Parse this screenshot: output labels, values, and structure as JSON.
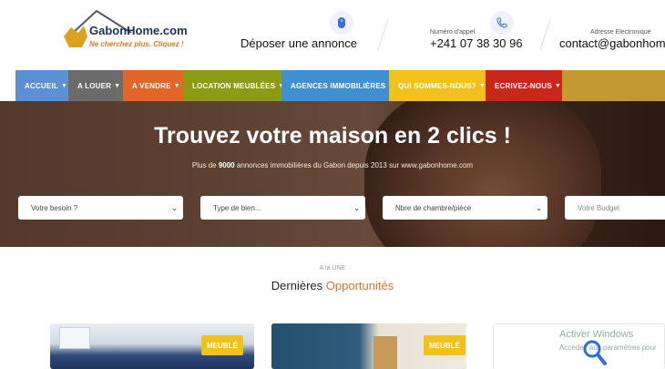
{
  "header": {
    "logo_name": "GabonHome.com",
    "logo_tagline": "Ne cherchez plus. Cliquez !",
    "post_ad_label": "Déposer une annonce",
    "phone_caption": "Numéro d'appel",
    "phone_number": "+241 07 38 30 96",
    "email_caption": "Adresse Electronique",
    "email_value": "contact@gabonhome"
  },
  "nav": {
    "items": [
      {
        "label": "ACCUEIL",
        "color": "#5b8fd6"
      },
      {
        "label": "A LOUER",
        "color": "#6b6b6b"
      },
      {
        "label": "A VENDRE",
        "color": "#e0662a"
      },
      {
        "label": "LOCATION MEUBLÉES",
        "color": "#8c9a14"
      },
      {
        "label": "AGENCES IMMOBILIÈRES",
        "color": "#3f8fd1"
      },
      {
        "label": "QUI SOMMES-NOUS?",
        "color": "#f2c21b"
      },
      {
        "label": "ECRIVEZ-NOUS",
        "color": "#c9261c"
      }
    ]
  },
  "hero": {
    "title": "Trouvez votre maison en 2 clics !",
    "sub_before": "Plus de ",
    "sub_bold": "9000",
    "sub_after": " annonces immobilières du Gabon depuis 2013 sur www.gabonhome.com",
    "selects": [
      {
        "label": "Votre besoin ?"
      },
      {
        "label": "Type de bien..."
      },
      {
        "label": "Nbre de chambre/pièce"
      },
      {
        "label": "Votre Budget"
      }
    ]
  },
  "section": {
    "kicker": "A la UNE",
    "title_plain": "Dernières ",
    "title_accent": "Opportunités"
  },
  "cards": [
    {
      "badge": "MEUBLÉ"
    },
    {
      "badge": "MEUBLÉ"
    }
  ],
  "watermark": {
    "title": "Activer Windows",
    "sub": "Accédez aux paramètres pour"
  }
}
